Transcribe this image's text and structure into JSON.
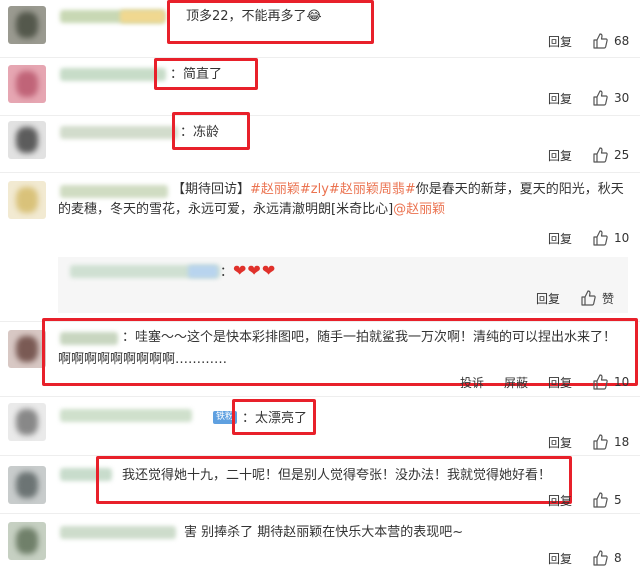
{
  "comments": [
    {
      "text": "顶多22，不能再多了",
      "emoji": "😂",
      "reply": "回复",
      "likes": "68"
    },
    {
      "text": "：简直了",
      "reply": "回复",
      "likes": "30"
    },
    {
      "text": "：冻龄",
      "reply": "回复",
      "likes": "25"
    },
    {
      "text_prefix": "【期待回访】",
      "tags": "#赵丽颖#zly#赵丽颖周翡#",
      "text_rest": "你是春天的新芽，夏天的阳光，秋天的麦穗，冬天的雪花，永远可爱，永远清澈明朗[米奇比心]",
      "mention": "@赵丽颖",
      "reply": "回复",
      "likes": "10",
      "sub_reply": {
        "prefix": "：",
        "hearts": "❤❤❤",
        "reply": "回复",
        "like_label": "赞"
      }
    },
    {
      "text": "：哇塞～～这个是快本彩排图吧，随手一拍就鲨我一万次啊！清纯的可以捏出水来了！",
      "text_line2": "啊啊啊啊啊啊啊啊啊…………",
      "report": "投诉",
      "block": "屏蔽",
      "reply": "回复",
      "likes": "10"
    },
    {
      "badge": "铁粉",
      "text": "：太漂亮了",
      "reply": "回复",
      "likes": "18"
    },
    {
      "text": "我还觉得她十九，二十呢！但是别人觉得夸张！没办法！我就觉得她好看！",
      "reply": "回复",
      "likes": "5"
    },
    {
      "text": "害 别捧杀了 期待赵丽颖在快乐大本营的表现吧~",
      "reply": "回复",
      "likes": "8"
    }
  ],
  "colors": {
    "highlight_box": "#e8202a",
    "topic_tag": "#eb7350",
    "text": "#333333"
  },
  "icons": {
    "like": "thumbs-up-icon"
  }
}
